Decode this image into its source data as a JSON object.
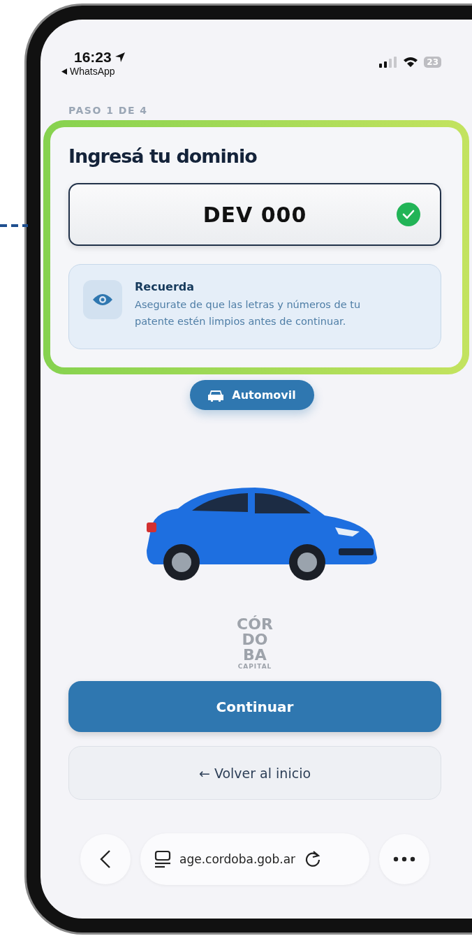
{
  "status_bar": {
    "time": "16:23",
    "back_app": "WhatsApp",
    "battery": "23"
  },
  "step": "PASO 1 DE 4",
  "highlight": {
    "highlighted": true,
    "title": "Ingresá tu dominio",
    "plate_field": {
      "value": "DEV 000",
      "valid": true
    },
    "tip": {
      "title": "Recuerda",
      "text": "Asegurate de que las letras y números de tu patente estén limpios antes de continuar."
    }
  },
  "vehicle_chip": "Automovil",
  "logo": {
    "lines": [
      "CÓR",
      "DO",
      "BA"
    ],
    "caption": "CAPITAL"
  },
  "primary_button": "Continuar",
  "secondary_button": "← Volver al inicio",
  "browser_bar": {
    "url": "age.cordoba.gob.ar"
  }
}
